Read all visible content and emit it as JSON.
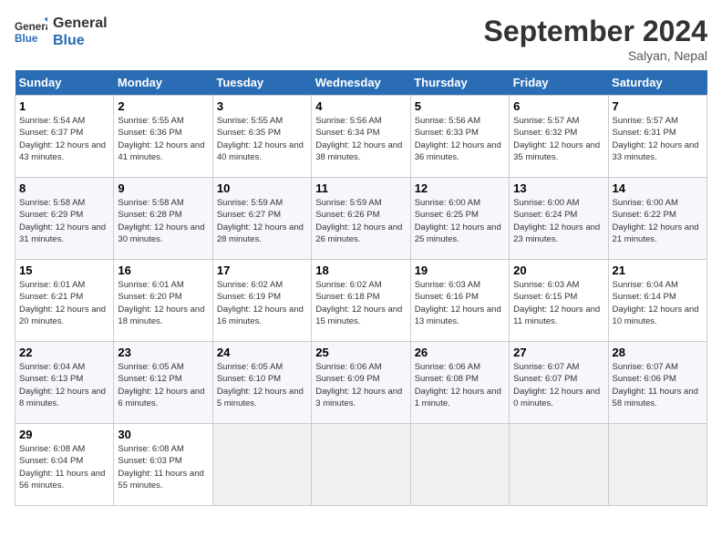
{
  "header": {
    "logo_line1": "General",
    "logo_line2": "Blue",
    "month": "September 2024",
    "location": "Salyan, Nepal"
  },
  "days_of_week": [
    "Sunday",
    "Monday",
    "Tuesday",
    "Wednesday",
    "Thursday",
    "Friday",
    "Saturday"
  ],
  "weeks": [
    [
      {
        "num": "1",
        "sunrise": "Sunrise: 5:54 AM",
        "sunset": "Sunset: 6:37 PM",
        "daylight": "Daylight: 12 hours and 43 minutes."
      },
      {
        "num": "2",
        "sunrise": "Sunrise: 5:55 AM",
        "sunset": "Sunset: 6:36 PM",
        "daylight": "Daylight: 12 hours and 41 minutes."
      },
      {
        "num": "3",
        "sunrise": "Sunrise: 5:55 AM",
        "sunset": "Sunset: 6:35 PM",
        "daylight": "Daylight: 12 hours and 40 minutes."
      },
      {
        "num": "4",
        "sunrise": "Sunrise: 5:56 AM",
        "sunset": "Sunset: 6:34 PM",
        "daylight": "Daylight: 12 hours and 38 minutes."
      },
      {
        "num": "5",
        "sunrise": "Sunrise: 5:56 AM",
        "sunset": "Sunset: 6:33 PM",
        "daylight": "Daylight: 12 hours and 36 minutes."
      },
      {
        "num": "6",
        "sunrise": "Sunrise: 5:57 AM",
        "sunset": "Sunset: 6:32 PM",
        "daylight": "Daylight: 12 hours and 35 minutes."
      },
      {
        "num": "7",
        "sunrise": "Sunrise: 5:57 AM",
        "sunset": "Sunset: 6:31 PM",
        "daylight": "Daylight: 12 hours and 33 minutes."
      }
    ],
    [
      {
        "num": "8",
        "sunrise": "Sunrise: 5:58 AM",
        "sunset": "Sunset: 6:29 PM",
        "daylight": "Daylight: 12 hours and 31 minutes."
      },
      {
        "num": "9",
        "sunrise": "Sunrise: 5:58 AM",
        "sunset": "Sunset: 6:28 PM",
        "daylight": "Daylight: 12 hours and 30 minutes."
      },
      {
        "num": "10",
        "sunrise": "Sunrise: 5:59 AM",
        "sunset": "Sunset: 6:27 PM",
        "daylight": "Daylight: 12 hours and 28 minutes."
      },
      {
        "num": "11",
        "sunrise": "Sunrise: 5:59 AM",
        "sunset": "Sunset: 6:26 PM",
        "daylight": "Daylight: 12 hours and 26 minutes."
      },
      {
        "num": "12",
        "sunrise": "Sunrise: 6:00 AM",
        "sunset": "Sunset: 6:25 PM",
        "daylight": "Daylight: 12 hours and 25 minutes."
      },
      {
        "num": "13",
        "sunrise": "Sunrise: 6:00 AM",
        "sunset": "Sunset: 6:24 PM",
        "daylight": "Daylight: 12 hours and 23 minutes."
      },
      {
        "num": "14",
        "sunrise": "Sunrise: 6:00 AM",
        "sunset": "Sunset: 6:22 PM",
        "daylight": "Daylight: 12 hours and 21 minutes."
      }
    ],
    [
      {
        "num": "15",
        "sunrise": "Sunrise: 6:01 AM",
        "sunset": "Sunset: 6:21 PM",
        "daylight": "Daylight: 12 hours and 20 minutes."
      },
      {
        "num": "16",
        "sunrise": "Sunrise: 6:01 AM",
        "sunset": "Sunset: 6:20 PM",
        "daylight": "Daylight: 12 hours and 18 minutes."
      },
      {
        "num": "17",
        "sunrise": "Sunrise: 6:02 AM",
        "sunset": "Sunset: 6:19 PM",
        "daylight": "Daylight: 12 hours and 16 minutes."
      },
      {
        "num": "18",
        "sunrise": "Sunrise: 6:02 AM",
        "sunset": "Sunset: 6:18 PM",
        "daylight": "Daylight: 12 hours and 15 minutes."
      },
      {
        "num": "19",
        "sunrise": "Sunrise: 6:03 AM",
        "sunset": "Sunset: 6:16 PM",
        "daylight": "Daylight: 12 hours and 13 minutes."
      },
      {
        "num": "20",
        "sunrise": "Sunrise: 6:03 AM",
        "sunset": "Sunset: 6:15 PM",
        "daylight": "Daylight: 12 hours and 11 minutes."
      },
      {
        "num": "21",
        "sunrise": "Sunrise: 6:04 AM",
        "sunset": "Sunset: 6:14 PM",
        "daylight": "Daylight: 12 hours and 10 minutes."
      }
    ],
    [
      {
        "num": "22",
        "sunrise": "Sunrise: 6:04 AM",
        "sunset": "Sunset: 6:13 PM",
        "daylight": "Daylight: 12 hours and 8 minutes."
      },
      {
        "num": "23",
        "sunrise": "Sunrise: 6:05 AM",
        "sunset": "Sunset: 6:12 PM",
        "daylight": "Daylight: 12 hours and 6 minutes."
      },
      {
        "num": "24",
        "sunrise": "Sunrise: 6:05 AM",
        "sunset": "Sunset: 6:10 PM",
        "daylight": "Daylight: 12 hours and 5 minutes."
      },
      {
        "num": "25",
        "sunrise": "Sunrise: 6:06 AM",
        "sunset": "Sunset: 6:09 PM",
        "daylight": "Daylight: 12 hours and 3 minutes."
      },
      {
        "num": "26",
        "sunrise": "Sunrise: 6:06 AM",
        "sunset": "Sunset: 6:08 PM",
        "daylight": "Daylight: 12 hours and 1 minute."
      },
      {
        "num": "27",
        "sunrise": "Sunrise: 6:07 AM",
        "sunset": "Sunset: 6:07 PM",
        "daylight": "Daylight: 12 hours and 0 minutes."
      },
      {
        "num": "28",
        "sunrise": "Sunrise: 6:07 AM",
        "sunset": "Sunset: 6:06 PM",
        "daylight": "Daylight: 11 hours and 58 minutes."
      }
    ],
    [
      {
        "num": "29",
        "sunrise": "Sunrise: 6:08 AM",
        "sunset": "Sunset: 6:04 PM",
        "daylight": "Daylight: 11 hours and 56 minutes."
      },
      {
        "num": "30",
        "sunrise": "Sunrise: 6:08 AM",
        "sunset": "Sunset: 6:03 PM",
        "daylight": "Daylight: 11 hours and 55 minutes."
      },
      null,
      null,
      null,
      null,
      null
    ]
  ]
}
